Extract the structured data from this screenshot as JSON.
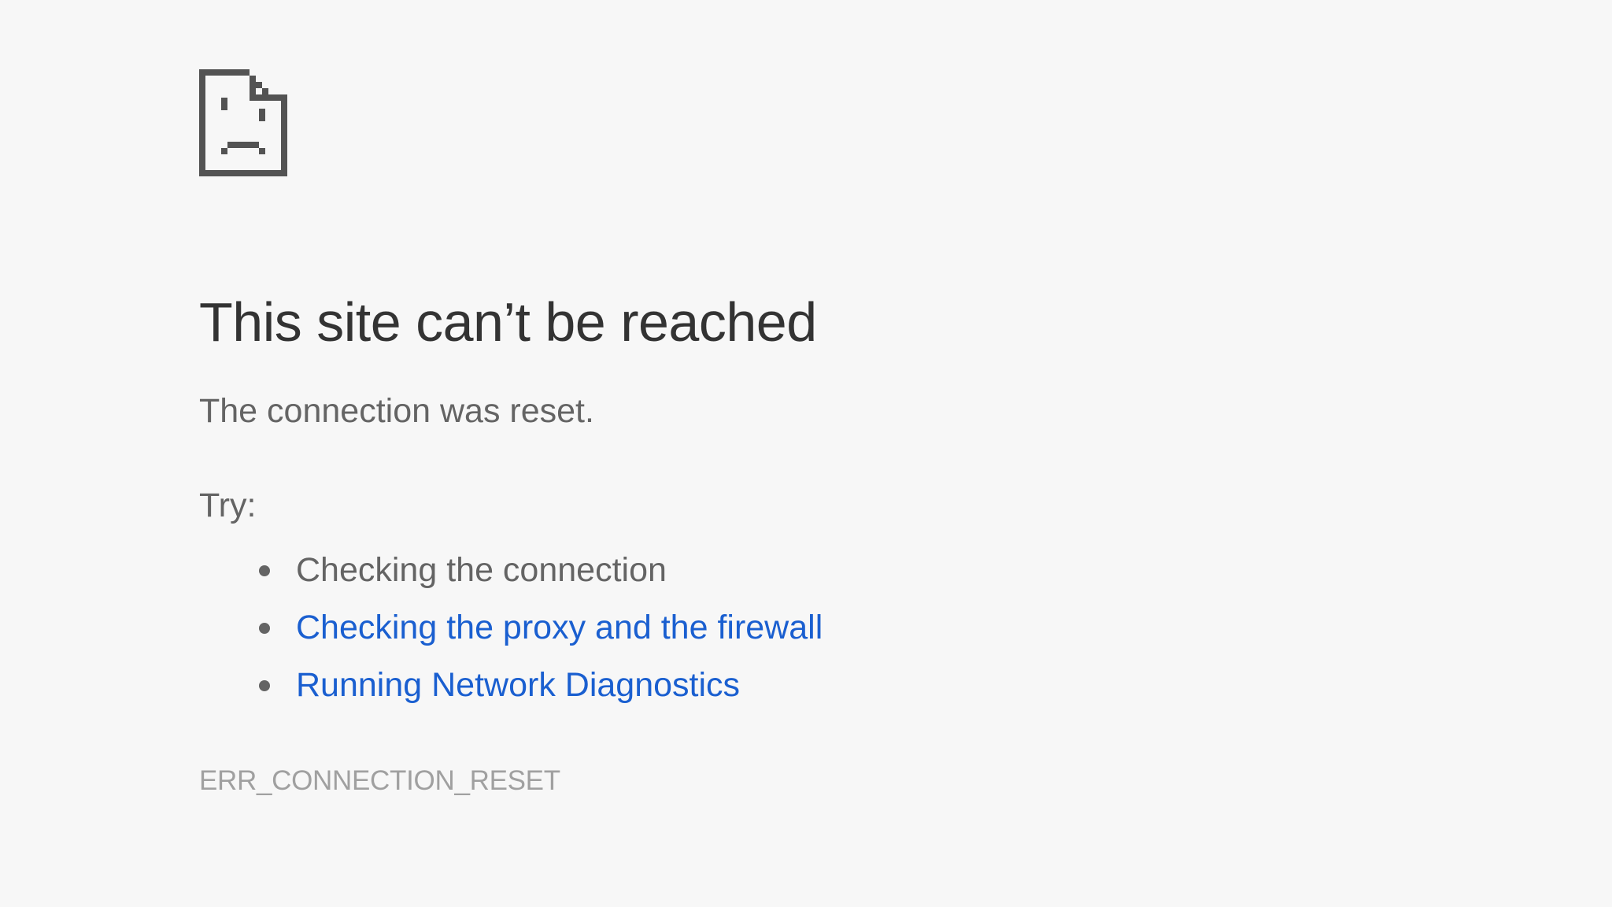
{
  "error_page": {
    "icon": "sad-document-icon",
    "heading": "This site can’t be reached",
    "message": "The connection was reset.",
    "try_label": "Try:",
    "suggestions": [
      {
        "label": "Checking the connection",
        "is_link": false
      },
      {
        "label": "Checking the proxy and the firewall",
        "is_link": true
      },
      {
        "label": "Running Network Diagnostics",
        "is_link": true
      }
    ],
    "error_code": "ERR_CONNECTION_RESET"
  },
  "colors": {
    "background": "#f7f7f7",
    "heading_text": "#333333",
    "body_text": "#646464",
    "link": "#1a5fd0",
    "error_code_text": "#a0a0a0",
    "icon": "#535353"
  }
}
